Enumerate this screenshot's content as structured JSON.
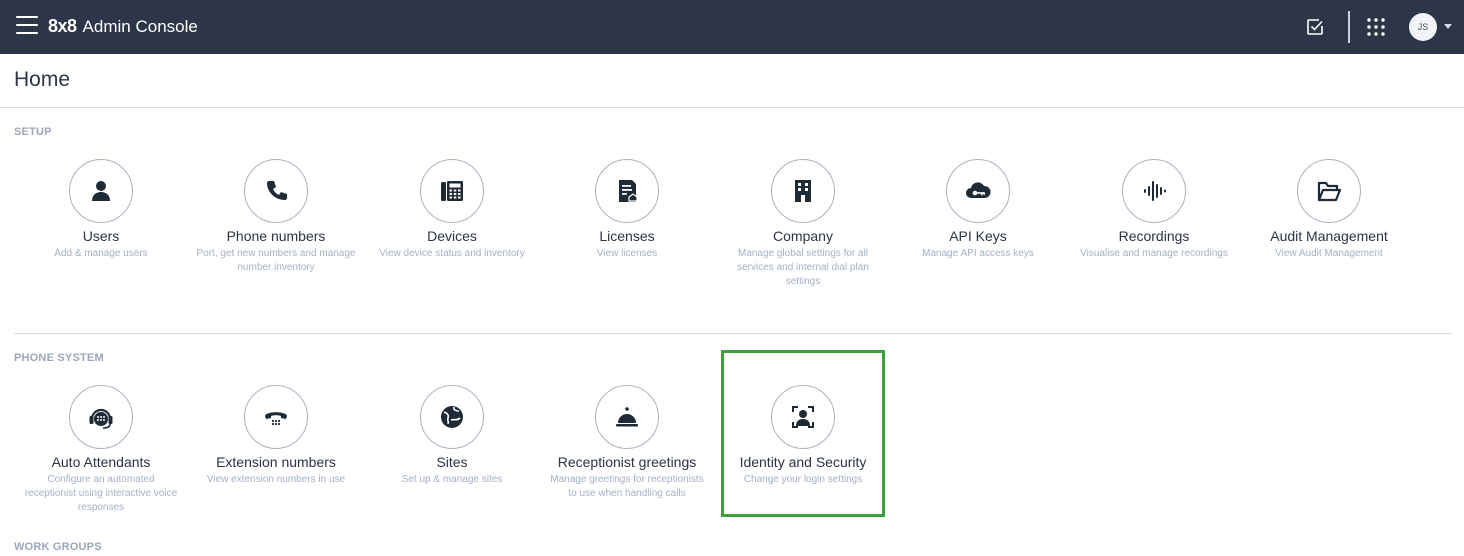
{
  "header": {
    "brand_logo": "8x8",
    "brand_title": "Admin Console",
    "avatar_initials": "JS",
    "colors": {
      "bar": "#2c3648",
      "highlight": "#3aa33a"
    }
  },
  "page": {
    "title": "Home"
  },
  "sections": {
    "setup": {
      "label": "SETUP",
      "tiles": [
        {
          "icon": "user-icon",
          "label": "Users",
          "desc": "Add & manage users"
        },
        {
          "icon": "phone-icon",
          "label": "Phone numbers",
          "desc": "Port, get new numbers and manage number inventory"
        },
        {
          "icon": "desk-phone-icon",
          "label": "Devices",
          "desc": "View device status and inventory"
        },
        {
          "icon": "license-icon",
          "label": "Licenses",
          "desc": "View licenses"
        },
        {
          "icon": "building-icon",
          "label": "Company",
          "desc": "Manage global settings for all services and internal dial plan settings"
        },
        {
          "icon": "cloud-key-icon",
          "label": "API Keys",
          "desc": "Manage API access keys"
        },
        {
          "icon": "soundwave-icon",
          "label": "Recordings",
          "desc": "Visualise and manage recordings"
        },
        {
          "icon": "folder-open-icon",
          "label": "Audit Management",
          "desc": "View Audit Management"
        }
      ]
    },
    "phone_system": {
      "label": "PHONE SYSTEM",
      "tiles": [
        {
          "icon": "headset-icon",
          "label": "Auto Attendants",
          "desc": "Configure an automated receptionist using interactive voice responses"
        },
        {
          "icon": "rotary-phone-icon",
          "label": "Extension numbers",
          "desc": "View extension numbers in use"
        },
        {
          "icon": "globe-icon",
          "label": "Sites",
          "desc": "Set up & manage sites"
        },
        {
          "icon": "service-bell-icon",
          "label": "Receptionist greetings",
          "desc": "Manage greetings for receptionists to use when handling calls"
        },
        {
          "icon": "face-scan-icon",
          "label": "Identity and Security",
          "desc": "Change your login settings"
        }
      ]
    },
    "work_groups": {
      "label": "WORK GROUPS"
    }
  }
}
